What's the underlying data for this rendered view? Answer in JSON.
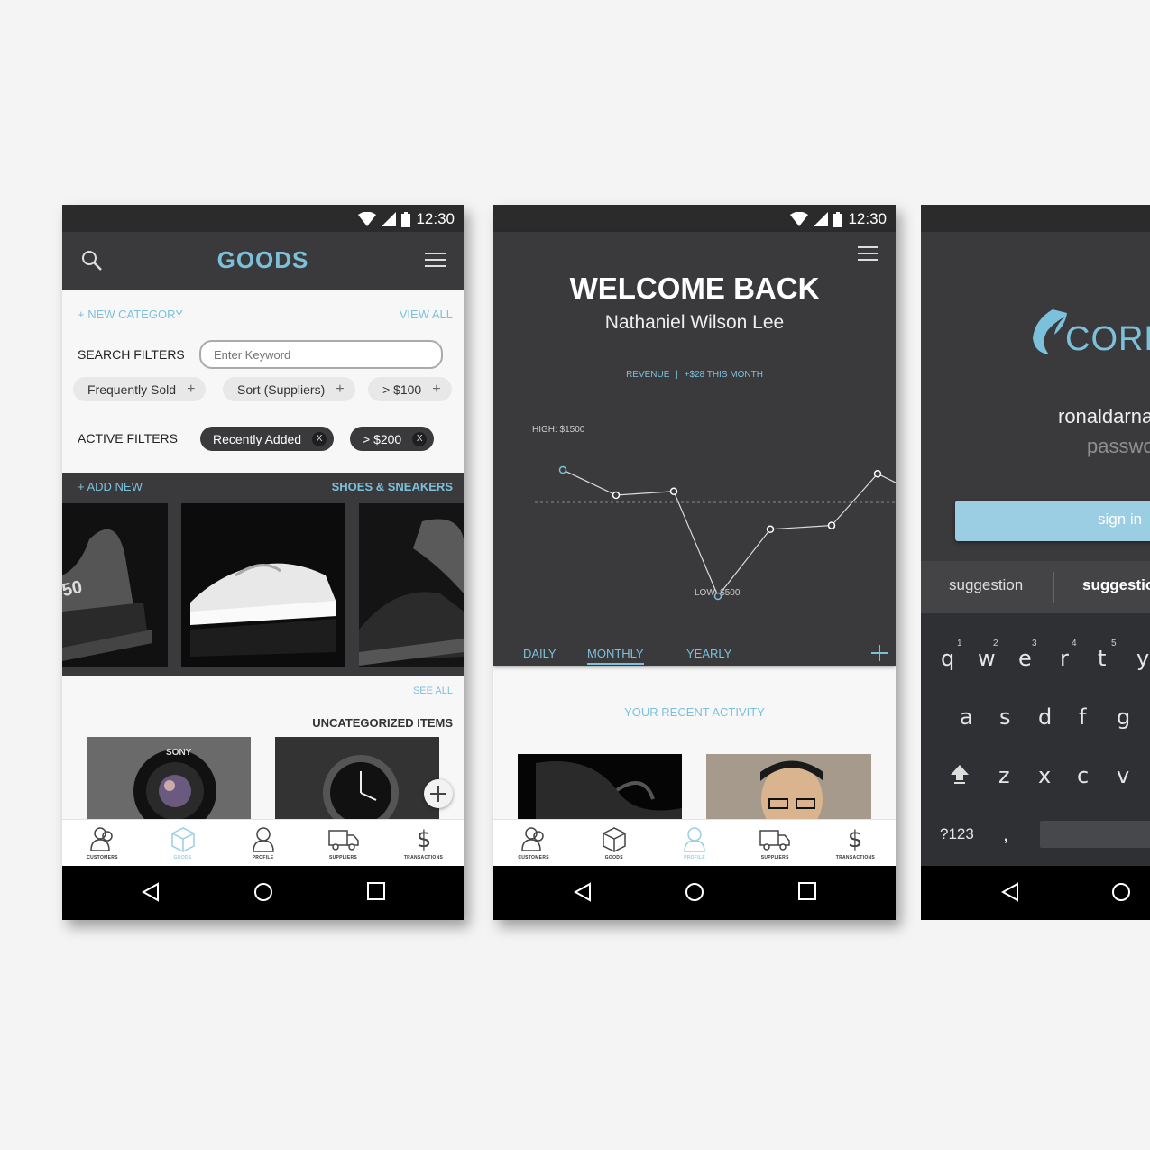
{
  "status": {
    "time": "12:30"
  },
  "goods": {
    "title": "GOODS",
    "new_category": "+ NEW CATEGORY",
    "view_all": "VIEW ALL",
    "search_filters_label": "SEARCH FILTERS",
    "search_placeholder": "Enter Keyword",
    "filter_chips": [
      "Frequently Sold",
      "Sort (Suppliers)",
      "> $100"
    ],
    "active_filters_label": "ACTIVE FILTERS",
    "active_chips": [
      "Recently Added",
      "> $200"
    ],
    "chip_remove": "X",
    "add_new": "+ ADD NEW",
    "shoes_title": "SHOES & SNEAKERS",
    "shoe_text": "50",
    "see_all": "SEE ALL",
    "uncategorized_title": "UNCATEGORIZED ITEMS",
    "camera_brand": "SONY"
  },
  "profile": {
    "welcome": "WELCOME BACK",
    "name": "Nathaniel Wilson Lee",
    "revenue_label": "REVENUE",
    "revenue_sep": "|",
    "revenue_change": "+$28 THIS MONTH",
    "high_label": "HIGH: $1500",
    "low_label": "LOW: $500",
    "tabs": [
      "DAILY",
      "MONTHLY",
      "YEARLY"
    ],
    "recent_activity": "YOUR RECENT ACTIVITY"
  },
  "chart_data": {
    "type": "line",
    "series": [
      {
        "values": [
          1500,
          1300,
          1330,
          500,
          1030,
          1060,
          1470,
          1350
        ]
      }
    ],
    "annotations": [
      "HIGH: $1500",
      "LOW: $500"
    ],
    "ylim": [
      500,
      1500
    ]
  },
  "login": {
    "logo_text": "CORR",
    "username": "ronaldarna",
    "password_placeholder": "passwo",
    "sign_in": "sign in",
    "suggestions": [
      "suggestion",
      "suggestio"
    ],
    "keys_row1": [
      "q",
      "w",
      "e",
      "r",
      "t",
      "y"
    ],
    "keys_row1_nums": [
      "1",
      "2",
      "3",
      "4",
      "5"
    ],
    "keys_row2": [
      "a",
      "s",
      "d",
      "f",
      "g"
    ],
    "keys_row3": [
      "z",
      "x",
      "c",
      "v"
    ],
    "key_symbols": "?123",
    "key_comma": ","
  },
  "bottom_nav": [
    "CUSTOMERS",
    "GOODS",
    "PROFILE",
    "SUPPLIERS",
    "TRANSACTIONS"
  ],
  "colors": {
    "accent": "#7cc1dc",
    "dark": "#3a3a3c",
    "status": "#2b2b2c"
  }
}
